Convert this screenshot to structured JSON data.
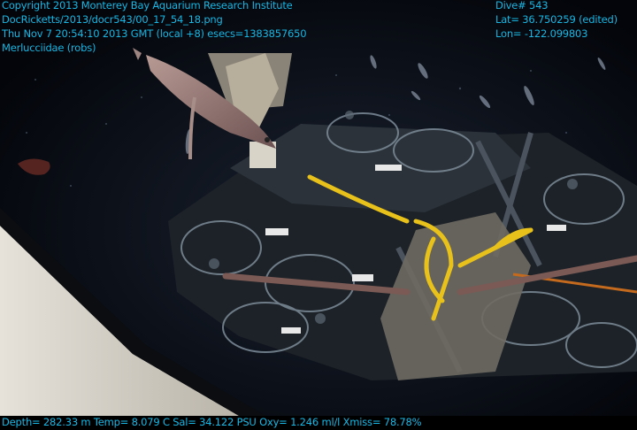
{
  "overlay": {
    "top_left": [
      "Copyright 2013 Monterey Bay Aquarium Research Institute",
      "DocRicketts/2013/docr543/00_17_54_18.png",
      "Thu Nov  7 20:54:10 2013 GMT (local +8)  esecs=1383857650",
      "Merlucciidae (robs)"
    ],
    "top_right": [
      "Dive# 543",
      "Lat= 36.750259 (edited)",
      "Lon= -122.099803"
    ],
    "bottom": "Depth= 282.33 m  Temp= 8.079 C  Sal= 34.122 PSU  Oxy= 1.246 ml/l  Xmiss= 78.78%"
  },
  "colors": {
    "overlay_text": "#18b8e6",
    "water": "#05070c",
    "tether_yellow": "#e8c21a"
  },
  "scene": {
    "subject": "hake-fish",
    "equipment": "rov-sampling-tray"
  }
}
